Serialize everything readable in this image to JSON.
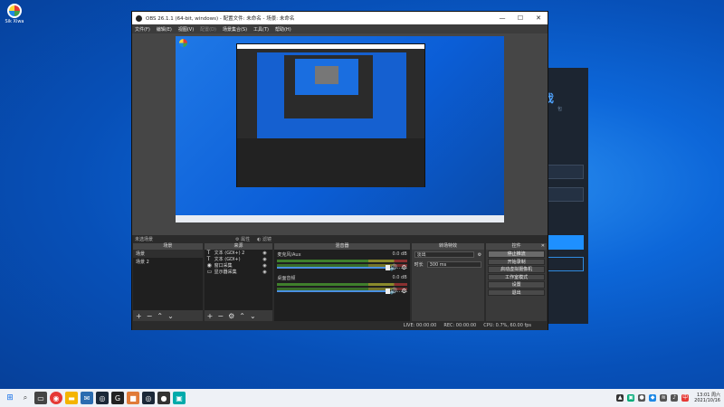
{
  "desktop": {
    "icon_label": "Sik Xiwa"
  },
  "background_window": {
    "heading": "戏",
    "sub": "包"
  },
  "obs": {
    "title": "OBS 26.1.1 (64-bit, windows) - 配置文件: 未命名 - 场景: 未命名",
    "window_controls": {
      "minimize": "—",
      "maximize": "☐",
      "close": "✕"
    },
    "menu": [
      "文件(F)",
      "编辑(E)",
      "视图(V)",
      "配置(D)",
      "场景集合(S)",
      "工具(T)",
      "帮助(H)"
    ],
    "no_scene_selected": "未选场景",
    "props_button": "属性",
    "filters_button": "滤镜",
    "scenes": {
      "header": "场景",
      "items": [
        "场景",
        "场景 2"
      ]
    },
    "sources": {
      "header": "来源",
      "items": [
        {
          "icon": "text-icon",
          "glyph": "T",
          "name": "文本 (GDI+) 2"
        },
        {
          "icon": "text-icon",
          "glyph": "T",
          "name": "文本 (GDI+)"
        },
        {
          "icon": "camera-icon",
          "glyph": "◉",
          "name": "窗口采集"
        },
        {
          "icon": "display-icon",
          "glyph": "▭",
          "name": "显示器采集"
        }
      ]
    },
    "mixer": {
      "header": "混音器",
      "channels": [
        {
          "name": "麦克风/Aux",
          "db": "0.0 dB"
        },
        {
          "name": "桌面音频",
          "db": "0.0 dB"
        }
      ]
    },
    "transitions": {
      "header": "转场特效",
      "type": "淡出",
      "duration_label": "时长",
      "duration_value": "300 ms"
    },
    "controls": {
      "header": "控件",
      "buttons": [
        "停止推流",
        "开始录制",
        "启动虚拟摄像机",
        "工作室模式",
        "设置",
        "退出"
      ]
    },
    "status": {
      "live": "LIVE: 00:00:00",
      "rec": "REC: 00:00:00",
      "cpu": "CPU: 0.7%, 60.00 fps"
    }
  },
  "taskbar": {
    "clock_time": "13:01 周六",
    "clock_date": "2021/10/16"
  },
  "colors": {
    "accent": "#1e90ff",
    "obs_bg": "#2b2b2b",
    "desktop": "#0d67d9"
  }
}
